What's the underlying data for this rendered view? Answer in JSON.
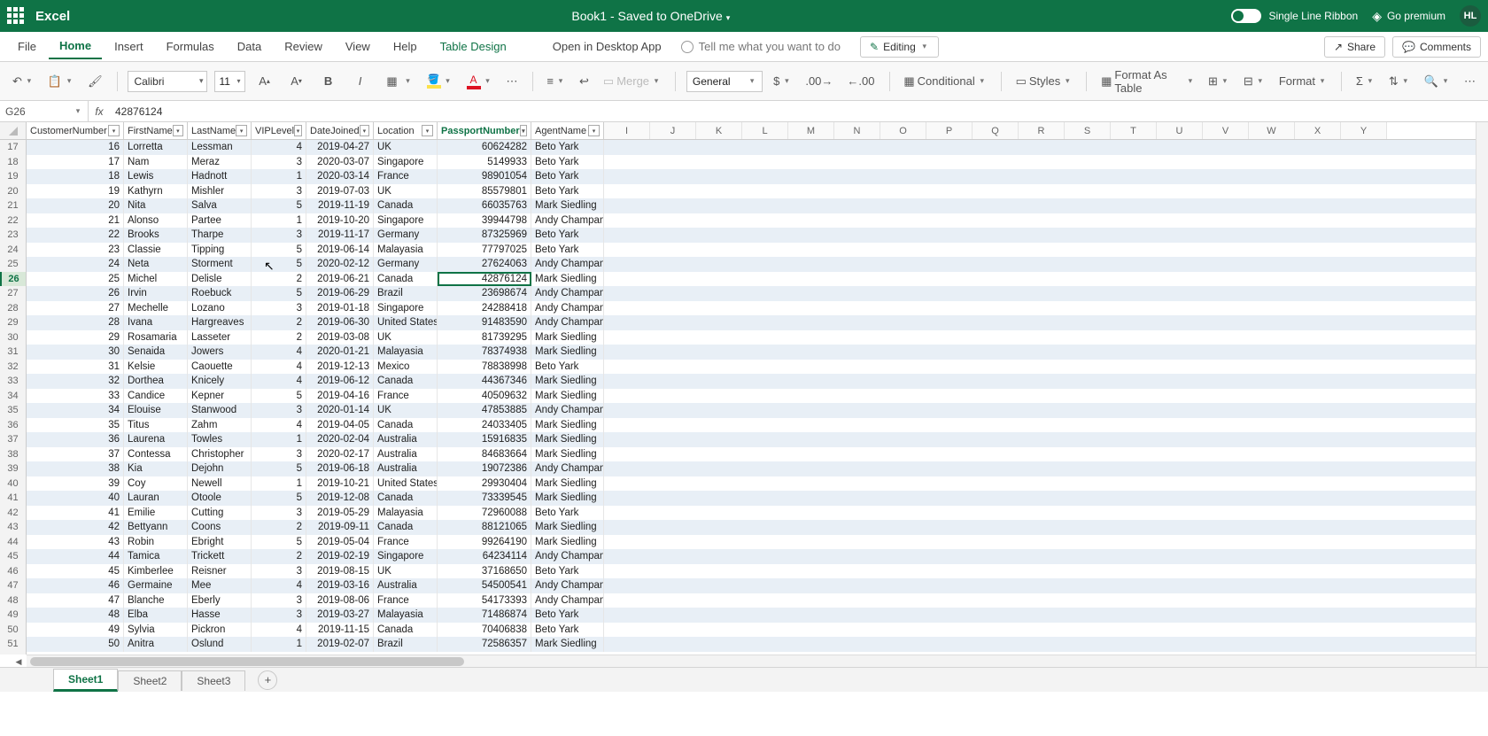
{
  "titlebar": {
    "app_name": "Excel",
    "doc_title": "Book1 - Saved to OneDrive",
    "single_line_ribbon": "Single Line Ribbon",
    "go_premium": "Go premium",
    "user_initials": "HL"
  },
  "tabs": {
    "file": "File",
    "home": "Home",
    "insert": "Insert",
    "formulas": "Formulas",
    "data": "Data",
    "review": "Review",
    "view": "View",
    "help": "Help",
    "table_design": "Table Design",
    "open_desktop": "Open in Desktop App",
    "tell_me": "Tell me what you want to do",
    "editing": "Editing",
    "share": "Share",
    "comments": "Comments"
  },
  "ribbon": {
    "font_name": "Calibri",
    "font_size": "11",
    "merge": "Merge",
    "number_format": "General",
    "conditional": "Conditional",
    "styles": "Styles",
    "format_as_table": "Format As Table",
    "format": "Format"
  },
  "fx": {
    "name_box": "G26",
    "formula": "42876124"
  },
  "headers": {
    "cols": [
      "CustomerNumber",
      "FirstName",
      "LastName",
      "VIPLevel",
      "DateJoined",
      "Location",
      "PassportNumber",
      "AgentName"
    ],
    "letters": [
      "I",
      "J",
      "K",
      "L",
      "M",
      "N",
      "O",
      "P",
      "Q",
      "R",
      "S",
      "T",
      "U",
      "V",
      "W",
      "X",
      "Y"
    ]
  },
  "selected_header_idx": 6,
  "selected_row_num": 26,
  "first_row_num": 17,
  "rows": [
    [
      16,
      "Lorretta",
      "Lessman",
      4,
      "2019-04-27",
      "UK",
      60624282,
      "Beto Yark"
    ],
    [
      17,
      "Nam",
      "Meraz",
      3,
      "2020-03-07",
      "Singapore",
      5149933,
      "Beto Yark"
    ],
    [
      18,
      "Lewis",
      "Hadnott",
      1,
      "2020-03-14",
      "France",
      98901054,
      "Beto Yark"
    ],
    [
      19,
      "Kathyrn",
      "Mishler",
      3,
      "2019-07-03",
      "UK",
      85579801,
      "Beto Yark"
    ],
    [
      20,
      "Nita",
      "Salva",
      5,
      "2019-11-19",
      "Canada",
      66035763,
      "Mark Siedling"
    ],
    [
      21,
      "Alonso",
      "Partee",
      1,
      "2019-10-20",
      "Singapore",
      39944798,
      "Andy Champan"
    ],
    [
      22,
      "Brooks",
      "Tharpe",
      3,
      "2019-11-17",
      "Germany",
      87325969,
      "Beto Yark"
    ],
    [
      23,
      "Classie",
      "Tipping",
      5,
      "2019-06-14",
      "Malayasia",
      77797025,
      "Beto Yark"
    ],
    [
      24,
      "Neta",
      "Storment",
      5,
      "2020-02-12",
      "Germany",
      27624063,
      "Andy Champan"
    ],
    [
      25,
      "Michel",
      "Delisle",
      2,
      "2019-06-21",
      "Canada",
      42876124,
      "Mark Siedling"
    ],
    [
      26,
      "Irvin",
      "Roebuck",
      5,
      "2019-06-29",
      "Brazil",
      23698674,
      "Andy Champan"
    ],
    [
      27,
      "Mechelle",
      "Lozano",
      3,
      "2019-01-18",
      "Singapore",
      24288418,
      "Andy Champan"
    ],
    [
      28,
      "Ivana",
      "Hargreaves",
      2,
      "2019-06-30",
      "United States",
      91483590,
      "Andy Champan"
    ],
    [
      29,
      "Rosamaria",
      "Lasseter",
      2,
      "2019-03-08",
      "UK",
      81739295,
      "Mark Siedling"
    ],
    [
      30,
      "Senaida",
      "Jowers",
      4,
      "2020-01-21",
      "Malayasia",
      78374938,
      "Mark Siedling"
    ],
    [
      31,
      "Kelsie",
      "Caouette",
      4,
      "2019-12-13",
      "Mexico",
      78838998,
      "Beto Yark"
    ],
    [
      32,
      "Dorthea",
      "Knicely",
      4,
      "2019-06-12",
      "Canada",
      44367346,
      "Mark Siedling"
    ],
    [
      33,
      "Candice",
      "Kepner",
      5,
      "2019-04-16",
      "France",
      40509632,
      "Mark Siedling"
    ],
    [
      34,
      "Elouise",
      "Stanwood",
      3,
      "2020-01-14",
      "UK",
      47853885,
      "Andy Champan"
    ],
    [
      35,
      "Titus",
      "Zahm",
      4,
      "2019-04-05",
      "Canada",
      24033405,
      "Mark Siedling"
    ],
    [
      36,
      "Laurena",
      "Towles",
      1,
      "2020-02-04",
      "Australia",
      15916835,
      "Mark Siedling"
    ],
    [
      37,
      "Contessa",
      "Christopher",
      3,
      "2020-02-17",
      "Australia",
      84683664,
      "Mark Siedling"
    ],
    [
      38,
      "Kia",
      "Dejohn",
      5,
      "2019-06-18",
      "Australia",
      19072386,
      "Andy Champan"
    ],
    [
      39,
      "Coy",
      "Newell",
      1,
      "2019-10-21",
      "United States",
      29930404,
      "Mark Siedling"
    ],
    [
      40,
      "Lauran",
      "Otoole",
      5,
      "2019-12-08",
      "Canada",
      73339545,
      "Mark Siedling"
    ],
    [
      41,
      "Emilie",
      "Cutting",
      3,
      "2019-05-29",
      "Malayasia",
      72960088,
      "Beto Yark"
    ],
    [
      42,
      "Bettyann",
      "Coons",
      2,
      "2019-09-11",
      "Canada",
      88121065,
      "Mark Siedling"
    ],
    [
      43,
      "Robin",
      "Ebright",
      5,
      "2019-05-04",
      "France",
      99264190,
      "Mark Siedling"
    ],
    [
      44,
      "Tamica",
      "Trickett",
      2,
      "2019-02-19",
      "Singapore",
      64234114,
      "Andy Champan"
    ],
    [
      45,
      "Kimberlee",
      "Reisner",
      3,
      "2019-08-15",
      "UK",
      37168650,
      "Beto Yark"
    ],
    [
      46,
      "Germaine",
      "Mee",
      4,
      "2019-03-16",
      "Australia",
      54500541,
      "Andy Champan"
    ],
    [
      47,
      "Blanche",
      "Eberly",
      3,
      "2019-08-06",
      "France",
      54173393,
      "Andy Champan"
    ],
    [
      48,
      "Elba",
      "Hasse",
      3,
      "2019-03-27",
      "Malayasia",
      71486874,
      "Beto Yark"
    ],
    [
      49,
      "Sylvia",
      "Pickron",
      4,
      "2019-11-15",
      "Canada",
      70406838,
      "Beto Yark"
    ],
    [
      50,
      "Anitra",
      "Oslund",
      1,
      "2019-02-07",
      "Brazil",
      72586357,
      "Mark Siedling"
    ]
  ],
  "sheet_tabs": [
    "Sheet1",
    "Sheet2",
    "Sheet3"
  ],
  "active_sheet_idx": 0
}
